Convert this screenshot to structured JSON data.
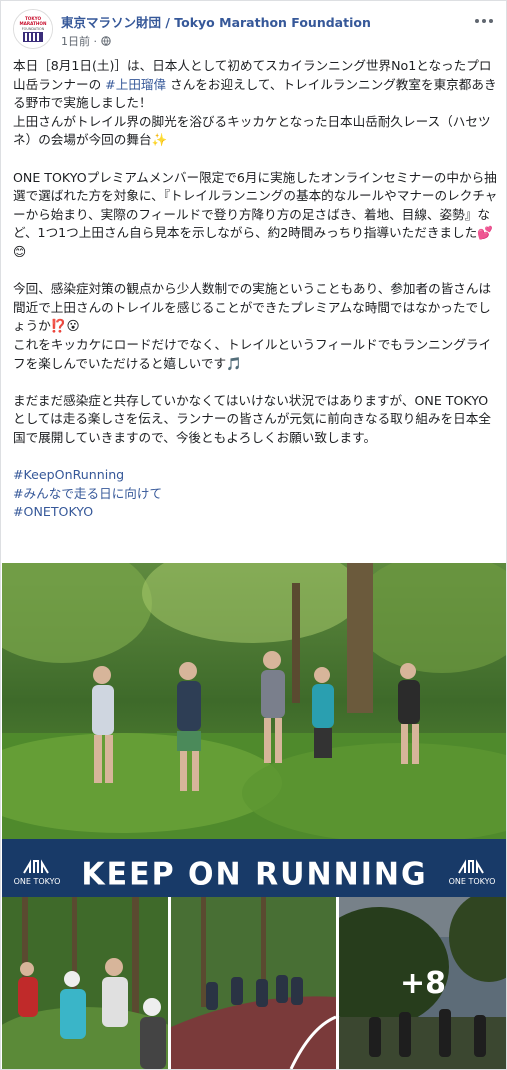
{
  "post": {
    "page_name": "東京マラソン財団 / Tokyo Marathon Foundation",
    "time": "1日前",
    "separator": "·",
    "more_icon": "more-dots-icon",
    "audience_icon": "globe-icon",
    "avatar_text": {
      "line1": "TOKYO",
      "line2": "MARATHON",
      "line3": "FOUNDATION"
    }
  },
  "text": {
    "p1_a": "本日［8月1日(土)］は、日本人として初めてスカイランニング世界No1となったプロ山岳ランナーの ",
    "p1_link": "#上田瑠偉",
    "p1_b": " さんをお迎えして、トレイルランニング教室を東京都あきる野市で実施しました！\n上田さんがトレイル界の脚光を浴びるキッカケとなった日本山岳耐久レース（ハセツネ）の会場が今回の舞台✨",
    "p2": "ONE TOKYOプレミアムメンバー限定で6月に実施したオンラインセミナーの中から抽選で選ばれた方を対象に、『トレイルランニングの基本的なルールやマナーのレクチャーから始まり、実際のフィールドで登り方降り方の足さばき、着地、目線、姿勢』など、1つ1つ上田さん自ら見本を示しながら、約2時間みっちり指導いただきました💕😊",
    "p3": "今回、感染症対策の観点から少人数制での実施ということもあり、参加者の皆さんは間近で上田さんのトレイルを感じることができたプレミアムな時間ではなかったでしょうか⁉️😮\nこれをキッカケにロードだけでなく、トレイルというフィールドでもランニングライフを楽しんでいただけると嬉しいです🎵",
    "p4": "まだまだ感染症と共存していかなくてはいけない状況ではありますが、ONE TOKYOとしては走る楽しさを伝え、ランナーの皆さんが元気に前向きなる取り組みを日本全国で展開していきますので、今後ともよろしくお願い致します。",
    "hashtags": [
      "#KeepOnRunning",
      "#みんなで走る日に向けて",
      "#ONETOKYO"
    ]
  },
  "media": {
    "banner_text": "KEEP ON RUNNING",
    "banner_logo": "ONE TOKYO",
    "more_count": "+8"
  },
  "colors": {
    "link": "#365899",
    "banner_bg": "#183a68"
  }
}
